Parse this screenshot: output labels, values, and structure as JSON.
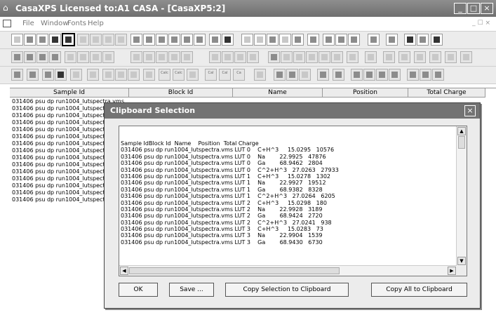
{
  "window": {
    "title": "CasaXPS Licensed to:A1 CASA - [CasaXP5:2]",
    "icon": "house-icon",
    "controls": [
      "minimize-icon",
      "restore-icon",
      "close-icon"
    ]
  },
  "menu": {
    "items": [
      "File",
      "Window",
      "Fonts",
      "Help"
    ],
    "mdi_controls": "_ ☐ ×"
  },
  "toolbar3_labels": {
    "a": "Calc",
    "b": "Calc",
    "c": "Cal",
    "d": "Cal",
    "e": "Ca"
  },
  "browser": {
    "columns": [
      "Sample Id",
      "Block Id",
      "Name",
      "Position",
      "Total Charge"
    ],
    "rows": [
      "031406 psu dp run1004_lutspectra.vms",
      "031406 psu dp run1004_lutspectra.",
      "031406 psu dp run1004_lutspectra.",
      "031406 psu dp run1004_lutspectra.",
      "031406 psu dp run1004_lutspectra.",
      "031406 psu dp run1004_lutspectra.",
      "031406 psu dp run1004_lutspectra.",
      "031406 psu dp run1004_lutspectra.",
      "031406 psu dp run1004_lutspectra.",
      "031406 psu dp run1004_lutspectra.",
      "031406 psu dp run1004_lutspectra.",
      "031406 psu dp run1004_lutspectra.",
      "031406 psu dp run1004_lutspectra.",
      "031406 psu dp run1004_lutspectra.",
      "031406 psu dp run1004_lutspectra."
    ]
  },
  "dialog": {
    "title": "Clipboard Selection",
    "header_line": "Sample IdBlock Id  Name    Position  Total Charge",
    "lines": [
      "031406 psu dp run1004_lutspectra.vms LUT 0    C+H^3     15.0295   10576",
      "031406 psu dp run1004_lutspectra.vms LUT 0    Na        22.9925   47876",
      "031406 psu dp run1004_lutspectra.vms LUT 0    Ga        68.9462   2804",
      "031406 psu dp run1004_lutspectra.vms LUT 0    C^2+H^3   27.0263   27933",
      "031406 psu dp run1004_lutspectra.vms LUT 1    C+H^3     15.0278   1302",
      "031406 psu dp run1004_lutspectra.vms LUT 1    Na        22.9927   19512",
      "031406 psu dp run1004_lutspectra.vms LUT 1    Ga        68.9382   8328",
      "031406 psu dp run1004_lutspectra.vms LUT 1    C^2+H^3   27.0264   6205",
      "031406 psu dp run1004_lutspectra.vms LUT 2    C+H^3     15.0298   180",
      "031406 psu dp run1004_lutspectra.vms LUT 2    Na        22.9928   3189",
      "031406 psu dp run1004_lutspectra.vms LUT 2    Ga        68.9424   2720",
      "031406 psu dp run1004_lutspectra.vms LUT 2    C^2+H^3   27.0241   938",
      "031406 psu dp run1004_lutspectra.vms LUT 3    C+H^3     15.0283   73",
      "031406 psu dp run1004_lutspectra.vms LUT 3    Na        22.9904   1539",
      "031406 psu dp run1004_lutspectra.vms LUT 3    Ga        68.9430   6730"
    ],
    "buttons": {
      "ok": "OK",
      "save": "Save ...",
      "copy_selection": "Copy Selection to Clipboard",
      "copy_all": "Copy All to Clipboard"
    }
  }
}
